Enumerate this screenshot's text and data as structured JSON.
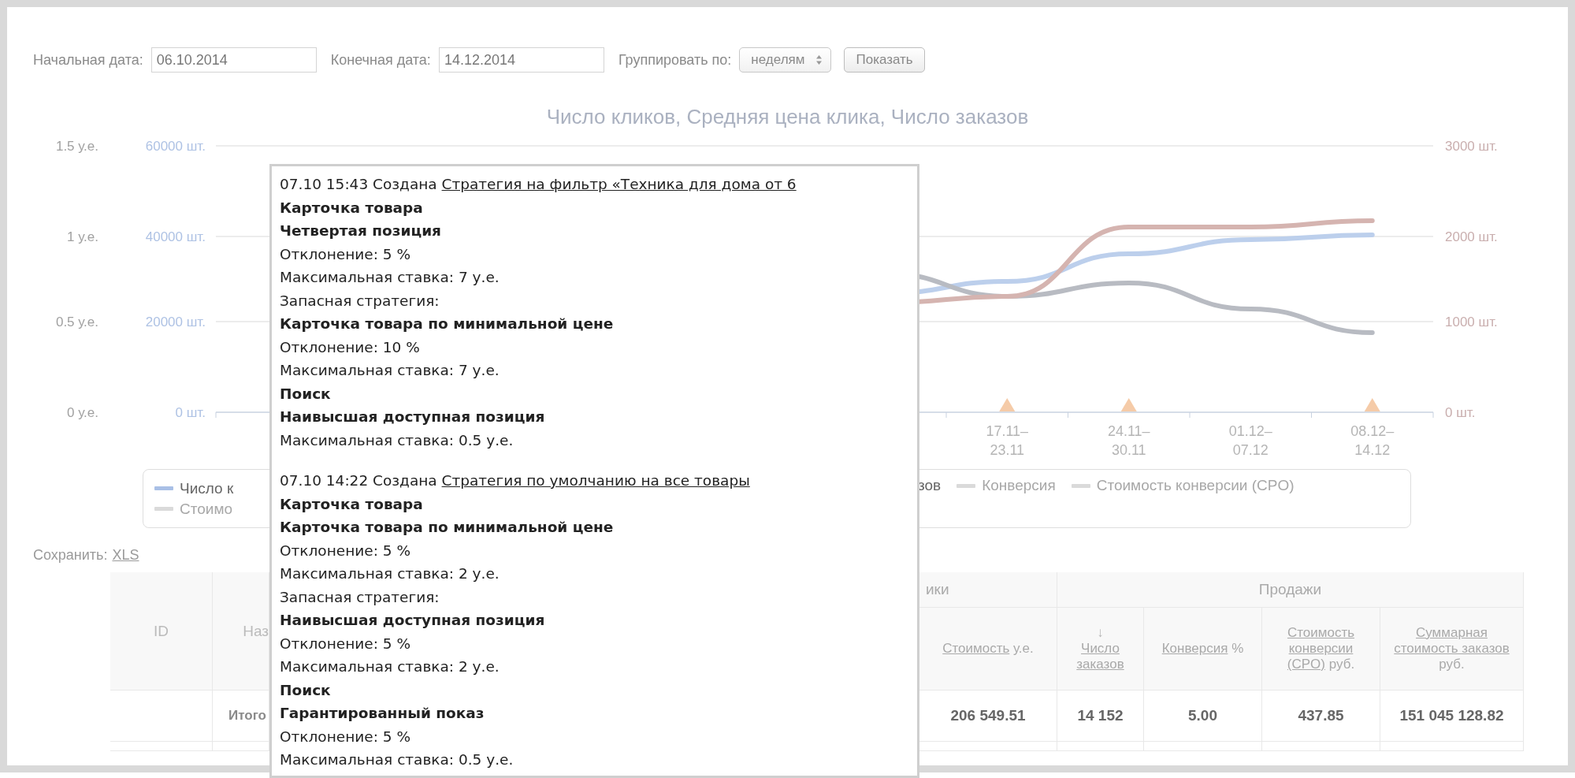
{
  "filters": {
    "start_label": "Начальная дата:",
    "start_value": "06.10.2014",
    "end_label": "Конечная дата:",
    "end_value": "14.12.2014",
    "group_label": "Группировать по:",
    "group_value": "неделям",
    "show_button": "Показать"
  },
  "chart": {
    "title": "Число кликов, Средняя цена клика, Число заказов",
    "left_axis_price": [
      "1.5 у.е.",
      "1 у.е.",
      "0.5 у.е.",
      "0 у.е."
    ],
    "left_axis_count": [
      "60000 шт.",
      "40000 шт.",
      "20000 шт.",
      "0 шт."
    ],
    "right_axis": [
      "3000 шт.",
      "2000 шт.",
      "1000 шт.",
      "0 шт."
    ],
    "x_labels": [
      {
        "lines": [
          "17.11–",
          "23.11"
        ],
        "event_marker": true
      },
      {
        "lines": [
          "24.11–",
          "30.11"
        ],
        "event_marker": true
      },
      {
        "lines": [
          "01.12–",
          "07.12"
        ],
        "event_marker": false
      },
      {
        "lines": [
          "08.12–",
          "14.12"
        ],
        "event_marker": true
      }
    ],
    "lines": [
      {
        "color": "#bccfec"
      },
      {
        "color": "#b8bbc2"
      },
      {
        "color": "#d5b4b0"
      }
    ]
  },
  "legend": {
    "left": [
      {
        "label": "Число к",
        "color": "#a9c0e6",
        "enabled": true
      },
      {
        "label": "Стоимо",
        "enabled": false
      }
    ],
    "right": [
      {
        "label": "зов",
        "enabled": true
      },
      {
        "label": "Конверсия",
        "enabled": false
      },
      {
        "label": "Стоимость конверсии (CPO)",
        "enabled": false
      }
    ]
  },
  "save": {
    "label": "Сохранить:",
    "link": "XLS"
  },
  "table": {
    "id_header": "ID",
    "name_header": "Наз",
    "groups": [
      {
        "label": "ики"
      },
      {
        "label": "Продажи"
      }
    ],
    "columns": [
      {
        "label": "Стоимость",
        "unit": "у.е."
      },
      {
        "label": "Число заказов",
        "sort": "↓"
      },
      {
        "label": "Конверсия",
        "unit": "%"
      },
      {
        "label": "Стоимость конверсии (CPO)",
        "unit": "руб."
      },
      {
        "label": "Суммарная стоимость заказов",
        "unit": "руб."
      }
    ],
    "rows": [
      {
        "name": "Итого",
        "cells": [
          "206 549.51",
          "14 152",
          "5.00",
          "437.85",
          "151 045 128.82"
        ]
      }
    ]
  },
  "tooltip": {
    "entries": [
      {
        "time": "07.10 15:43",
        "action": "Создана",
        "link": "Стратегия на фильтр «Техника для дома от 6",
        "lines": [
          {
            "text": "Карточка товара",
            "bold": true
          },
          {
            "text": "Четвертая позиция",
            "bold": true
          },
          {
            "text": "Отклонение: 5 %",
            "bold": false
          },
          {
            "text": "Максимальная ставка: 7 у.е.",
            "bold": false
          },
          {
            "text": "Запасная стратегия:",
            "bold": false
          },
          {
            "text": "Карточка товара по минимальной цене",
            "bold": true
          },
          {
            "text": "Отклонение: 10 %",
            "bold": false
          },
          {
            "text": "Максимальная ставка: 7 у.е.",
            "bold": false
          },
          {
            "text": "Поиск",
            "bold": true
          },
          {
            "text": "Наивысшая доступная позиция",
            "bold": true
          },
          {
            "text": "Максимальная ставка: 0.5 у.е.",
            "bold": false
          }
        ]
      },
      {
        "time": "07.10 14:22",
        "action": "Создана",
        "link": "Стратегия по умолчанию на все товары",
        "lines": [
          {
            "text": "Карточка товара",
            "bold": true
          },
          {
            "text": "Карточка товара по минимальной цене",
            "bold": true
          },
          {
            "text": "Отклонение: 5 %",
            "bold": false
          },
          {
            "text": "Максимальная ставка: 2 у.е.",
            "bold": false
          },
          {
            "text": "Запасная стратегия:",
            "bold": false
          },
          {
            "text": "Наивысшая доступная позиция",
            "bold": true
          },
          {
            "text": "Отклонение: 5 %",
            "bold": false
          },
          {
            "text": "Максимальная ставка: 2 у.е.",
            "bold": false
          },
          {
            "text": "Поиск",
            "bold": true
          },
          {
            "text": "Гарантированный показ",
            "bold": true
          },
          {
            "text": "Отклонение: 5 %",
            "bold": false
          },
          {
            "text": "Максимальная ставка: 0.5 у.е.",
            "bold": false
          }
        ]
      }
    ]
  }
}
